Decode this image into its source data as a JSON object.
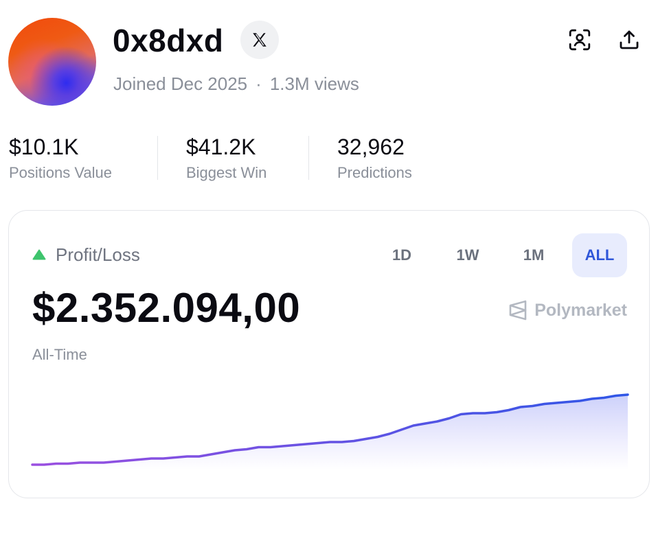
{
  "profile": {
    "username": "0x8dxd",
    "joined": "Joined Dec 2025",
    "separator": "·",
    "views": "1.3M views",
    "social_icon": "x-logo-icon",
    "actions": [
      "scan-profile-icon",
      "share-upload-icon"
    ]
  },
  "stats": [
    {
      "value": "$10.1K",
      "label": "Positions Value"
    },
    {
      "value": "$41.2K",
      "label": "Biggest Win"
    },
    {
      "value": "32,962",
      "label": "Predictions"
    }
  ],
  "pnl": {
    "label": "Profit/Loss",
    "trend_icon": "triangle-up-icon",
    "value": "$2.352.094,00",
    "period_label": "All-Time",
    "brand": "Polymarket",
    "ranges": [
      {
        "label": "1D",
        "active": false
      },
      {
        "label": "1W",
        "active": false
      },
      {
        "label": "1M",
        "active": false
      },
      {
        "label": "ALL",
        "active": true
      }
    ],
    "colors": {
      "up": "#3ec46d",
      "line_start": "#9b4fe0",
      "line_end": "#2f56e6",
      "active_range_bg": "#e8ecfd",
      "active_range_text": "#2f56d9"
    }
  },
  "chart_data": {
    "type": "area",
    "title": "",
    "xlabel": "",
    "ylabel": "",
    "x": [
      0,
      1,
      2,
      3,
      4,
      5,
      6,
      7,
      8,
      9,
      10,
      11,
      12,
      13,
      14,
      15,
      16,
      17,
      18,
      19,
      20,
      21,
      22,
      23,
      24,
      25,
      26,
      27,
      28,
      29,
      30,
      31,
      32,
      33,
      34,
      35,
      36,
      37,
      38,
      39,
      40,
      41,
      42,
      43,
      44,
      45,
      46,
      47,
      48,
      49,
      50
    ],
    "values": [
      0.0,
      0.0,
      0.01,
      0.01,
      0.02,
      0.02,
      0.02,
      0.03,
      0.04,
      0.05,
      0.06,
      0.06,
      0.07,
      0.08,
      0.08,
      0.1,
      0.12,
      0.14,
      0.15,
      0.17,
      0.17,
      0.18,
      0.19,
      0.2,
      0.21,
      0.22,
      0.22,
      0.23,
      0.25,
      0.27,
      0.3,
      0.34,
      0.38,
      0.4,
      0.42,
      0.45,
      0.49,
      0.5,
      0.5,
      0.51,
      0.53,
      0.56,
      0.57,
      0.59,
      0.6,
      0.61,
      0.62,
      0.64,
      0.65,
      0.67,
      0.68
    ],
    "ylim": [
      0,
      0.8
    ],
    "grid": false,
    "legend": "none"
  }
}
